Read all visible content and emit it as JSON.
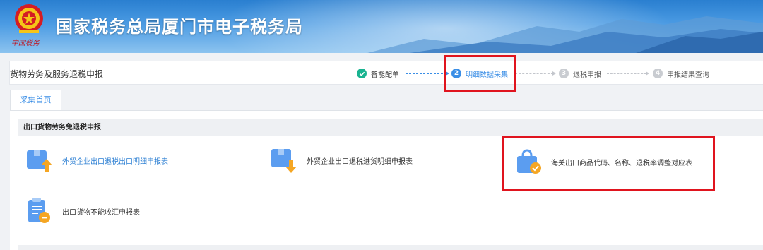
{
  "header": {
    "site_title": "国家税务总局厦门市电子税务局",
    "emblem_caption": "中国税务"
  },
  "stepbar": {
    "page_name": "货物劳务及服务退税申报",
    "steps": [
      {
        "number": "",
        "label": "智能配单",
        "state": "done"
      },
      {
        "number": "2",
        "label": "明细数据采集",
        "state": "current"
      },
      {
        "number": "3",
        "label": "退税申报",
        "state": "todo"
      },
      {
        "number": "4",
        "label": "申报结果查询",
        "state": "todo"
      }
    ]
  },
  "tabs": [
    {
      "label": "采集首页",
      "active": true
    }
  ],
  "section": {
    "title": "出口货物劳务免退税申报",
    "items": [
      {
        "label": "外贸企业出口退税出口明细申报表",
        "icon": "upload-box-icon"
      },
      {
        "label": "外贸企业出口退税进货明细申报表",
        "icon": "download-box-icon"
      },
      {
        "label": "海关出口商品代码、名称、退税率调整对应表",
        "icon": "shopping-bag-check-icon"
      },
      {
        "label": "出口货物不能收汇申报表",
        "icon": "clipboard-minus-icon"
      }
    ]
  },
  "colors": {
    "accent": "#3a8ee6",
    "done": "#19b390",
    "highlight": "#e0141e",
    "icon_blue": "#5b9df0",
    "icon_orange": "#f5a623"
  }
}
